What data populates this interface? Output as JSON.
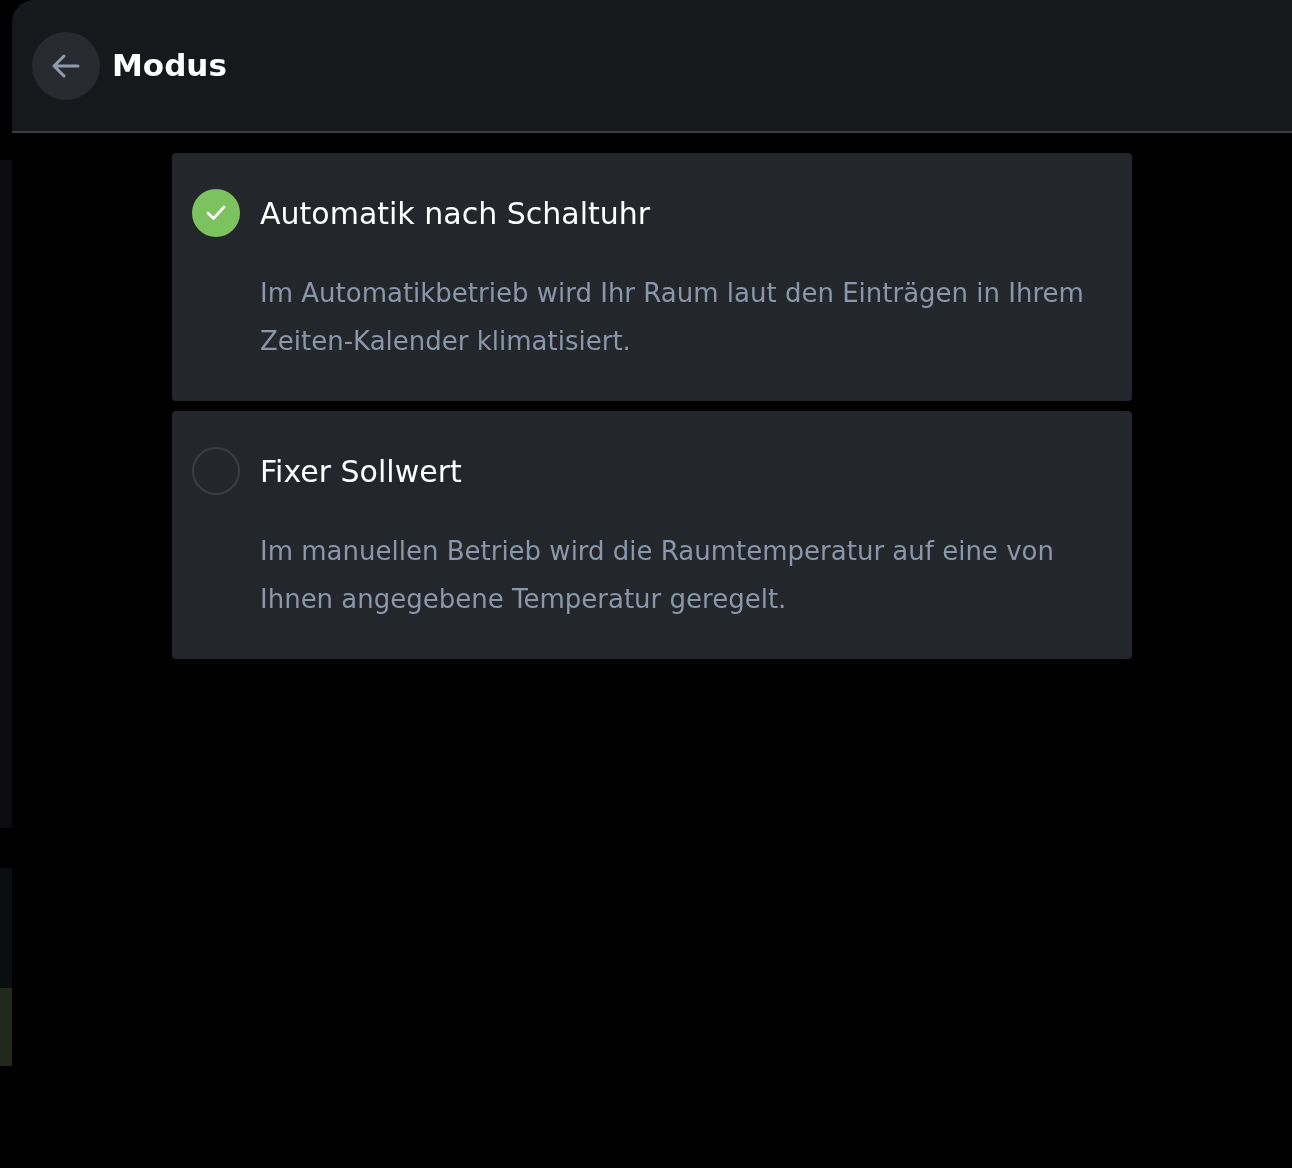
{
  "header": {
    "title": "Modus"
  },
  "options": [
    {
      "title": "Automatik nach Schaltuhr",
      "description": "Im Automatikbetrieb wird Ihr Raum laut den Einträgen in Ihrem Zeiten-Kalender klimatisiert.",
      "selected": true
    },
    {
      "title": "Fixer Sollwert",
      "description": "Im manuellen Betrieb wird die Raumtemperatur auf eine von Ihnen angegebene Temperatur geregelt.",
      "selected": false
    }
  ]
}
